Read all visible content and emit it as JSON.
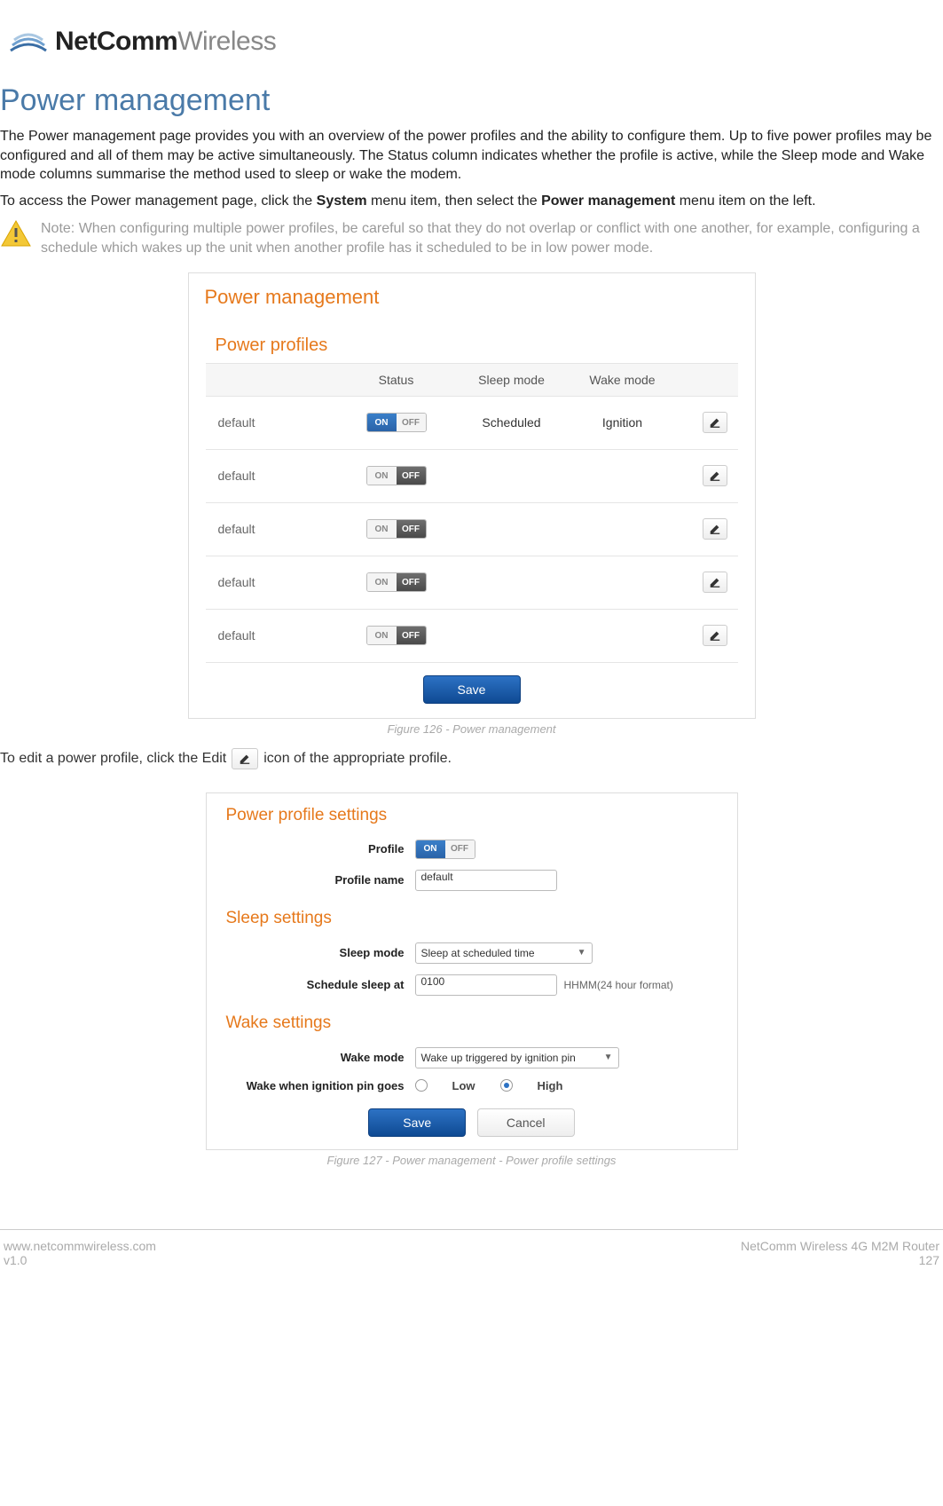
{
  "brand": {
    "bold": "NetComm",
    "light": "Wireless"
  },
  "heading": "Power management",
  "intro_p1": "The Power management page provides you with an overview of the power profiles and the ability to configure them. Up to five power profiles may be configured and all of them may be active simultaneously. The Status column indicates whether the profile is active, while the Sleep mode and Wake mode columns summarise the method used to sleep or wake the modem.",
  "intro_p2_pre": "To access the Power management page, click the ",
  "intro_p2_b1": "System",
  "intro_p2_mid": " menu item, then select the ",
  "intro_p2_b2": "Power management",
  "intro_p2_post": " menu item on the left.",
  "note": "Note: When configuring multiple power profiles, be careful so that they do not overlap or conflict with one another, for example, configuring a schedule which wakes up the unit when another profile has it scheduled to be in low power mode.",
  "panel1": {
    "title": "Power management",
    "subtitle": "Power profiles",
    "columns": {
      "status": "Status",
      "sleep": "Sleep mode",
      "wake": "Wake mode"
    },
    "toggle_labels": {
      "on": "ON",
      "off": "OFF"
    },
    "rows": [
      {
        "name": "default",
        "on": true,
        "sleep": "Scheduled",
        "wake": "Ignition"
      },
      {
        "name": "default",
        "on": false,
        "sleep": "",
        "wake": ""
      },
      {
        "name": "default",
        "on": false,
        "sleep": "",
        "wake": ""
      },
      {
        "name": "default",
        "on": false,
        "sleep": "",
        "wake": ""
      },
      {
        "name": "default",
        "on": false,
        "sleep": "",
        "wake": ""
      }
    ],
    "save": "Save"
  },
  "caption1": "Figure 126 - Power management",
  "edit_line_pre": "To edit a power profile, click the Edit ",
  "edit_line_post": " icon of the appropriate profile.",
  "panel2": {
    "title1": "Power profile settings",
    "profile_label": "Profile",
    "profile_name_label": "Profile name",
    "profile_name_value": "default",
    "title2": "Sleep settings",
    "sleep_mode_label": "Sleep mode",
    "sleep_mode_value": "Sleep at scheduled time",
    "schedule_label": "Schedule sleep at",
    "schedule_value": "0100",
    "schedule_hint": "HHMM(24 hour format)",
    "title3": "Wake settings",
    "wake_mode_label": "Wake mode",
    "wake_mode_value": "Wake up triggered by ignition pin",
    "wake_pin_label": "Wake when ignition pin goes",
    "radio_low": "Low",
    "radio_high": "High",
    "save": "Save",
    "cancel": "Cancel"
  },
  "caption2": "Figure 127 - Power management - Power profile settings",
  "footer": {
    "url": "www.netcommwireless.com",
    "ver": "v1.0",
    "product": "NetComm Wireless 4G M2M Router",
    "page": "127"
  }
}
